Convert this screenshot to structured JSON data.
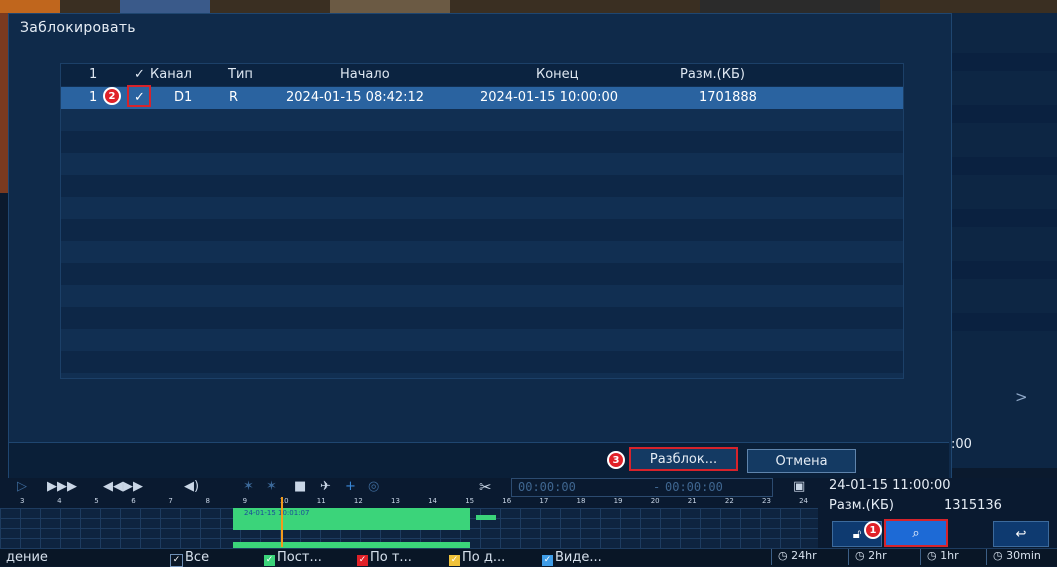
{
  "dialog": {
    "title": "Заблокировать",
    "table": {
      "headers": {
        "index": "1",
        "check": "✓",
        "channel": "Канал",
        "type": "Тип",
        "start": "Начало",
        "end": "Конец",
        "size": "Разм.(КБ)"
      },
      "rows": [
        {
          "index": "1",
          "check": "✓",
          "channel": "D1",
          "type": "R",
          "start": "2024-01-15 08:42:12",
          "end": "2024-01-15 10:00:00",
          "size": "1701888"
        }
      ]
    },
    "unlock_button": "Разблок...",
    "cancel_button": "Отмена"
  },
  "callouts": {
    "one": "1",
    "two": "2",
    "three": "3"
  },
  "playback": {
    "time_start": "00:00:00",
    "time_sep": "-",
    "time_end": "00:00:00",
    "ruler_ticks": [
      "3",
      "4",
      "5",
      "6",
      "7",
      "8",
      "9",
      "10",
      "11",
      "12",
      "13",
      "14",
      "15",
      "16",
      "17",
      "18",
      "19",
      "20",
      "21",
      "22",
      "23",
      "24"
    ],
    "cursor_label": "24-01-15 10:01:07"
  },
  "info": {
    "time": "24-01-15 11:00:00",
    "time_partial": ":00",
    "size_label": "Разм.(КБ)",
    "size_value": "1315136"
  },
  "legend": {
    "left_text": "дение",
    "all": "Все",
    "items": [
      "Пост...",
      "По т...",
      "По д...",
      "Виде..."
    ]
  },
  "zoom": [
    "24hr",
    "2hr",
    "1hr",
    "30min"
  ],
  "colors": {
    "accent_red": "#d7232b",
    "selected_row": "#2a63a0",
    "recording_green": "#3bd47a",
    "cursor_orange": "#f29a1b"
  },
  "icons": [
    "play-icon",
    "fast-forward-icon",
    "skip-icon",
    "volume-icon",
    "smart-search-icon",
    "camera-icon",
    "pin-icon",
    "tag-icon",
    "face-icon",
    "scissors-icon",
    "save-icon",
    "lock-icon",
    "search-image-icon",
    "back-icon"
  ]
}
